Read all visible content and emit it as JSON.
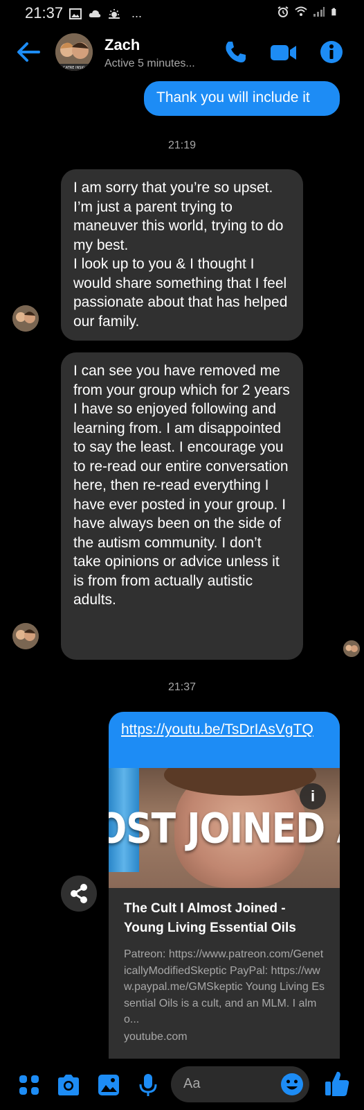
{
  "status_bar": {
    "time": "21:37",
    "overflow": "..."
  },
  "header": {
    "contact_name": "Zach",
    "contact_status": "Active 5 minutes...",
    "avatar_caption": "CATRE INSIG",
    "accent_color": "#1d8cf5"
  },
  "messages": [
    {
      "type": "outgoing",
      "text": "Thank you will include it"
    },
    {
      "type": "timestamp",
      "text": "21:19"
    },
    {
      "type": "incoming",
      "text": "I am sorry that you’re so upset. I’m just a parent trying to maneuver this world, trying to do my best.\nI look up to you & I thought I would share something that I feel passionate about that has helped our family."
    },
    {
      "type": "incoming",
      "text": "I can see you have removed me from your group which for 2 years I have so enjoyed following and learning from. I am disappointed to say the least. I encourage you to re-read our entire conversation here, then re-read everything I have ever posted in your group. I have always been on the side of the autism community. I don’t take opinions or advice unless it is from from actually autistic adults."
    },
    {
      "type": "timestamp",
      "text": "21:37"
    }
  ],
  "link_card": {
    "url": "https://youtu.be/TsDrIAsVgTQ",
    "thumbnail_caption": "OST JOINED A CU",
    "info_glyph": "i",
    "title": "The Cult I Almost Joined - Young Living Essential Oils",
    "description": "Patreon: https://www.patreon.com/GeneticallyModifiedSkeptic PayPal: https://www.paypal.me/GMSkeptic Young Living Essential Oils is a cult, and an MLM. I almo...",
    "domain": "youtube.com"
  },
  "composer": {
    "placeholder": "Aa"
  },
  "icons": {
    "status_left": [
      "image-icon",
      "cloud-icon",
      "weather-icon"
    ],
    "status_right": [
      "alarm-icon",
      "wifi-icon",
      "signal-icon",
      "battery-icon"
    ],
    "header": [
      "back-arrow-icon",
      "phone-icon",
      "video-icon",
      "info-icon"
    ],
    "composer": [
      "apps-icon",
      "camera-icon",
      "gallery-icon",
      "microphone-icon",
      "emoji-icon",
      "thumbs-up-icon"
    ]
  }
}
